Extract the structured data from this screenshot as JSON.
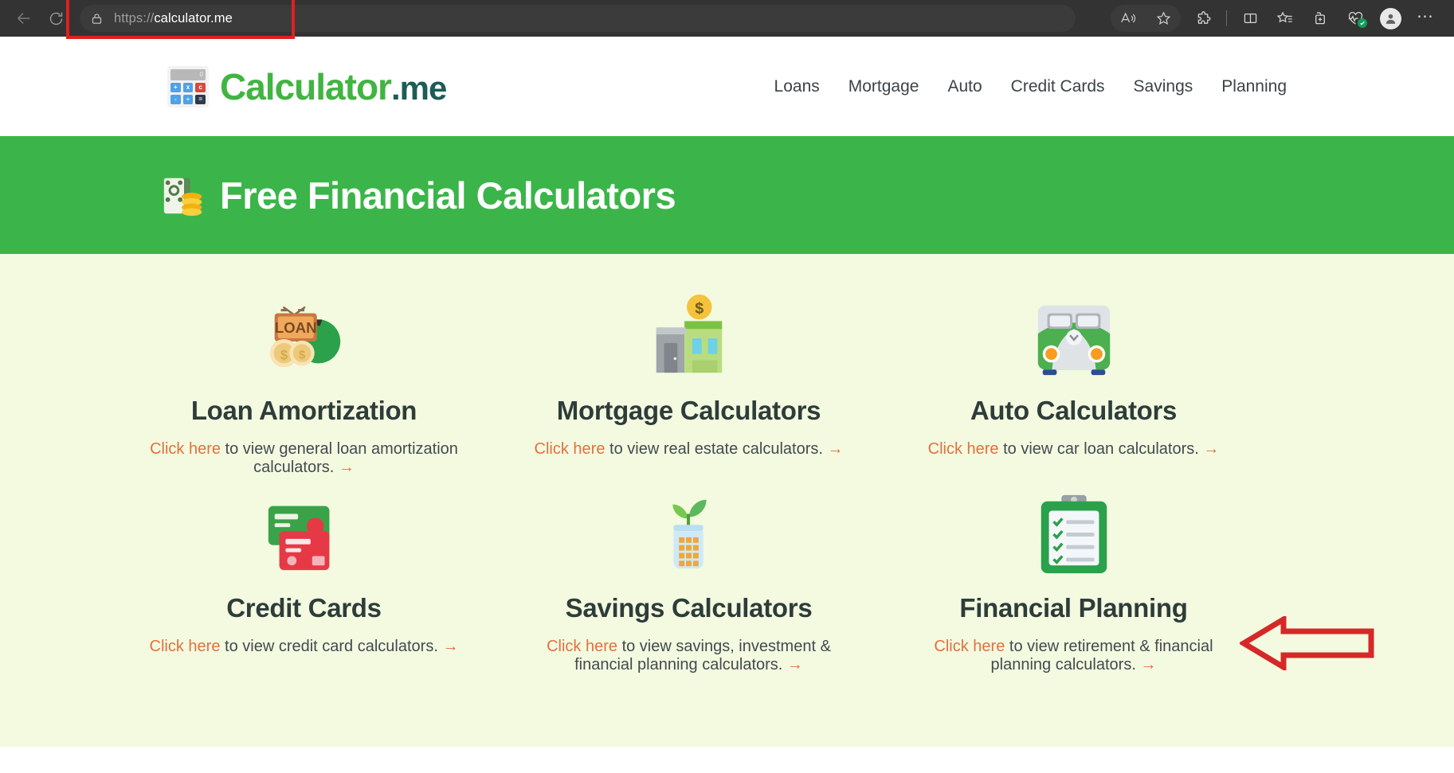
{
  "browser": {
    "back_label": "back-arrow",
    "reload_label": "reload",
    "url_display_scheme": "https://",
    "url_display_host": "calculator.me",
    "url_full": "https://calculator.me",
    "toolbar_icons": [
      {
        "name": "read-aloud-icon",
        "label": "Read aloud"
      },
      {
        "name": "favorite-star-icon",
        "label": "Add this page to favorites"
      },
      {
        "name": "extensions-icon",
        "label": "Extensions"
      },
      {
        "name": "split-screen-icon",
        "label": "Split screen"
      },
      {
        "name": "favorites-list-icon",
        "label": "Favorites"
      },
      {
        "name": "collections-icon",
        "label": "Collections"
      },
      {
        "name": "browser-essentials-icon",
        "label": "Browser essentials"
      },
      {
        "name": "profile-avatar",
        "label": "Profile"
      },
      {
        "name": "settings-more-icon",
        "label": "Settings and more"
      }
    ],
    "highlight_color": "#e02020"
  },
  "site": {
    "logo_name": "Calculator",
    "logo_tld": ".me",
    "logo_screen_text": "0",
    "logo_keys": [
      "+",
      "x",
      "c",
      "-",
      "÷",
      "="
    ],
    "nav": [
      {
        "label": "Loans"
      },
      {
        "label": "Mortgage"
      },
      {
        "label": "Auto"
      },
      {
        "label": "Credit Cards"
      },
      {
        "label": "Savings"
      },
      {
        "label": "Planning"
      }
    ]
  },
  "hero": {
    "icon": "money-with-coins-icon",
    "title": "Free Financial Calculators",
    "bg_color": "#3bb54a"
  },
  "cards": [
    {
      "icon": "loan-sign-money-bag-icon",
      "title": "Loan Amortization",
      "link_text": "Click here",
      "desc_text": " to view general loan amortization calculators. ",
      "arrow": "→"
    },
    {
      "icon": "house-with-dollar-icon",
      "title": "Mortgage Calculators",
      "link_text": "Click here",
      "desc_text": " to view real estate calculators. ",
      "arrow": "→"
    },
    {
      "icon": "green-van-icon",
      "title": "Auto Calculators",
      "link_text": "Click here",
      "desc_text": " to view car loan calculators. ",
      "arrow": "→"
    },
    {
      "icon": "credit-cards-icon",
      "title": "Credit Cards",
      "link_text": "Click here",
      "desc_text": " to view credit card calculators. ",
      "arrow": "→"
    },
    {
      "icon": "savings-jar-plant-icon",
      "title": "Savings Calculators",
      "link_text": "Click here",
      "desc_text": " to view savings, investment & financial planning calculators. ",
      "arrow": "→"
    },
    {
      "icon": "clipboard-checklist-icon",
      "title": "Financial Planning",
      "link_text": "Click here",
      "desc_text": " to view retirement & financial planning calculators. ",
      "arrow": "→"
    }
  ],
  "annotations": {
    "arrow_color": "#d62828",
    "arrow_direction": "left",
    "page_bg": "#f3fae0"
  }
}
